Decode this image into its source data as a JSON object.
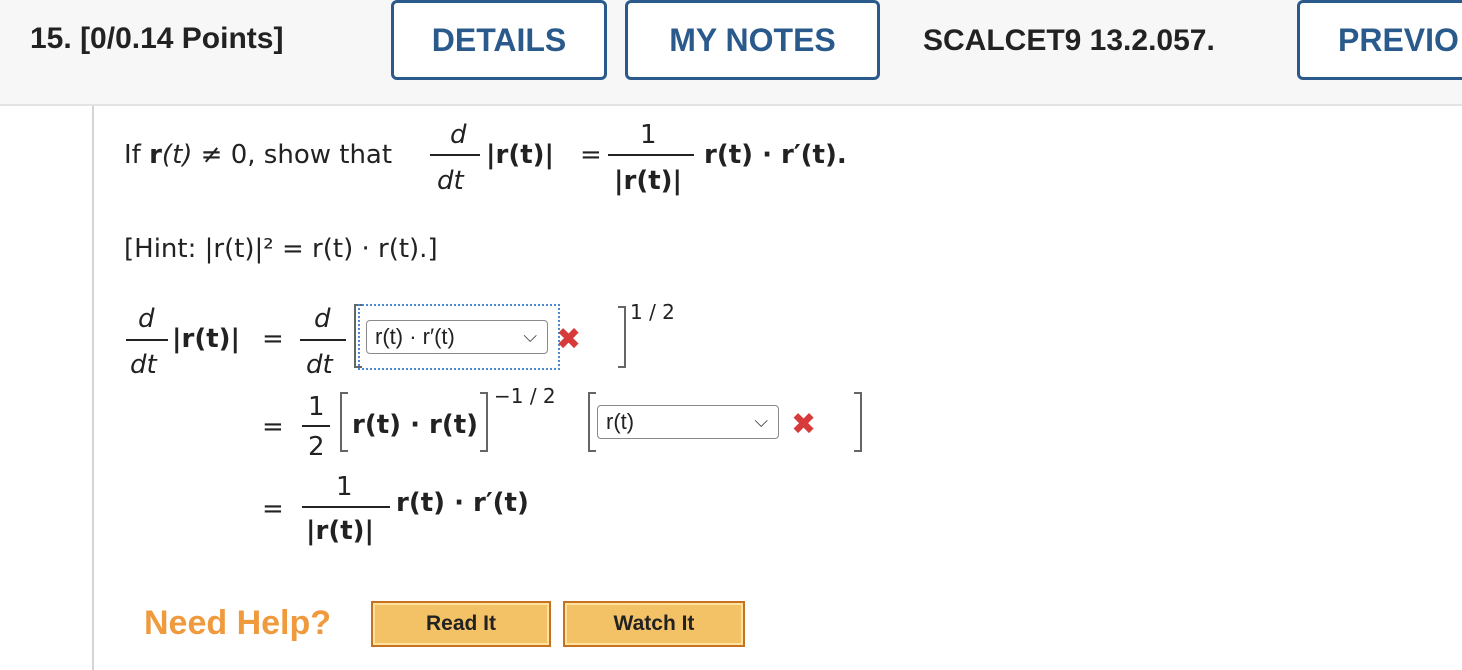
{
  "header": {
    "question_number": "15.",
    "points": "[0/0.14 Points]",
    "details_label": "DETAILS",
    "notes_label": "MY NOTES",
    "question_id": "SCALCET9 13.2.057.",
    "previous_label": "PREVIO"
  },
  "problem": {
    "if_prefix": "If",
    "r_bold": "r",
    "t_paren": "(t)",
    "neq_zero": "≠ 0, show that",
    "d": "d",
    "dt": "dt",
    "abs_r_t": "|r(t)|",
    "equals": "=",
    "one": "1",
    "rhs": "r(t) · r′(t).",
    "hint": "[Hint: |r(t)|² = r(t) · r(t).]"
  },
  "derivation": {
    "lhs_d": "d",
    "lhs_dt": "dt",
    "lhs_abs": "|r(t)|",
    "eq": "=",
    "line1_d": "d",
    "line1_dt": "dt",
    "line1_exp": "1 / 2",
    "select1_value": "r(t) · r′(t)",
    "line2_num": "1",
    "line2_den": "2",
    "line2_inner": "r(t) · r(t)",
    "line2_exp": "−1 / 2",
    "select2_value": "r(t)",
    "line3_num": "1",
    "line3_den": "|r(t)|",
    "line3_rest": "r(t) · r′(t)"
  },
  "status": {
    "select1_incorrect_icon": "x-mark-icon",
    "select2_incorrect_icon": "x-mark-icon",
    "incorrect_color": "#d63a3a"
  },
  "help": {
    "label": "Need Help?",
    "read_it": "Read It",
    "watch_it": "Watch It"
  }
}
